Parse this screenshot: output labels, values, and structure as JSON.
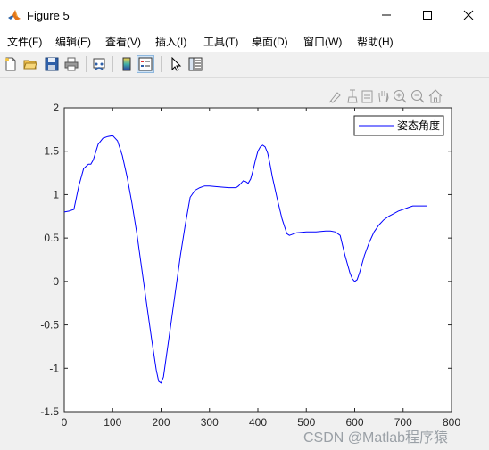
{
  "window": {
    "title": "Figure 5"
  },
  "menu": [
    "文件(F)",
    "编辑(E)",
    "查看(V)",
    "插入(I)",
    "工具(T)",
    "桌面(D)",
    "窗口(W)",
    "帮助(H)"
  ],
  "toolbar": {
    "icons": [
      "new-figure-icon",
      "open-file-icon",
      "save-icon",
      "print-icon",
      "link-plot-icon",
      "insert-colorbar-icon",
      "insert-legend-icon",
      "pointer-icon",
      "property-inspector-icon"
    ]
  },
  "axes_toolbar": {
    "icons": [
      "brush-icon",
      "data-cursor-icon",
      "export-icon",
      "pan-icon",
      "zoom-in-icon",
      "zoom-out-icon",
      "home-icon"
    ]
  },
  "watermark": "CSDN @Matlab程序猿",
  "chart_data": {
    "type": "line",
    "title": "",
    "xlabel": "",
    "ylabel": "",
    "xlim": [
      0,
      800
    ],
    "ylim": [
      -1.5,
      2
    ],
    "xticks": [
      "0",
      "100",
      "200",
      "300",
      "400",
      "500",
      "600",
      "700",
      "800"
    ],
    "yticks": [
      "2",
      "1.5",
      "1",
      "0.5",
      "0",
      "-0.5",
      "-1",
      "-1.5"
    ],
    "grid": false,
    "legend": {
      "position": "top-right"
    },
    "line_color": "#0000ff",
    "series": [
      {
        "name": "姿态角度",
        "x": [
          0,
          10,
          20,
          30,
          40,
          50,
          55,
          60,
          70,
          80,
          90,
          100,
          110,
          120,
          130,
          140,
          150,
          160,
          170,
          180,
          190,
          195,
          200,
          205,
          210,
          220,
          230,
          240,
          250,
          260,
          270,
          280,
          290,
          300,
          320,
          340,
          355,
          360,
          365,
          370,
          375,
          380,
          385,
          390,
          395,
          400,
          405,
          410,
          415,
          420,
          425,
          430,
          440,
          450,
          460,
          465,
          470,
          480,
          500,
          520,
          540,
          550,
          560,
          570,
          580,
          590,
          595,
          600,
          605,
          610,
          620,
          630,
          640,
          650,
          660,
          670,
          680,
          690,
          700,
          710,
          720,
          730,
          740,
          750
        ],
        "y": [
          0.8,
          0.81,
          0.83,
          1.1,
          1.3,
          1.35,
          1.35,
          1.4,
          1.58,
          1.65,
          1.67,
          1.68,
          1.62,
          1.45,
          1.2,
          0.9,
          0.55,
          0.15,
          -0.25,
          -0.65,
          -1.02,
          -1.15,
          -1.17,
          -1.1,
          -0.9,
          -0.5,
          -0.1,
          0.3,
          0.65,
          0.97,
          1.05,
          1.08,
          1.1,
          1.1,
          1.09,
          1.08,
          1.08,
          1.1,
          1.13,
          1.16,
          1.15,
          1.13,
          1.18,
          1.28,
          1.4,
          1.5,
          1.55,
          1.57,
          1.55,
          1.48,
          1.35,
          1.2,
          0.95,
          0.72,
          0.55,
          0.53,
          0.54,
          0.56,
          0.57,
          0.57,
          0.58,
          0.58,
          0.57,
          0.53,
          0.3,
          0.1,
          0.03,
          0.0,
          0.02,
          0.1,
          0.3,
          0.45,
          0.57,
          0.65,
          0.71,
          0.75,
          0.78,
          0.81,
          0.83,
          0.85,
          0.87,
          0.87,
          0.87,
          0.87
        ]
      }
    ]
  }
}
